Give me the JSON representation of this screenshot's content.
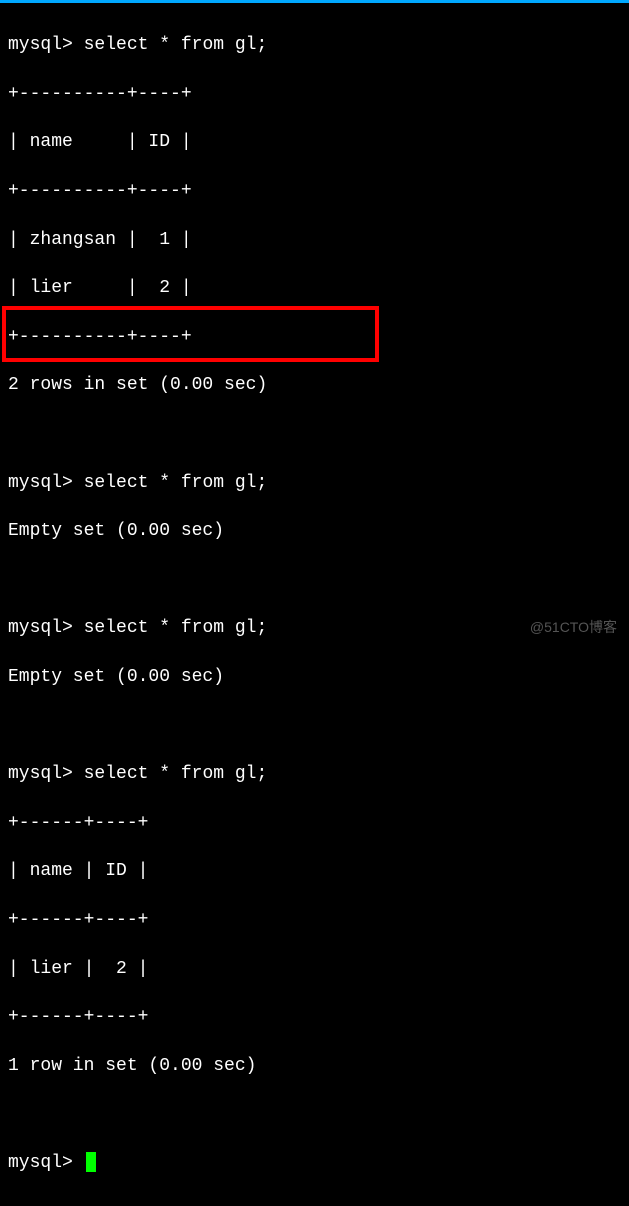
{
  "mysql_prompt": "mysql> ",
  "queries": {
    "q1": "select * from gl;",
    "q2": "select * from gl;",
    "q3": "select * from gl;",
    "q4": "select * from gl;"
  },
  "table1": {
    "border_top": "+----------+----+",
    "header": "| name     | ID |",
    "border_mid": "+----------+----+",
    "row1": "| zhangsan |  1 |",
    "row2": "| lier     |  2 |",
    "border_bot": "+----------+----+",
    "summary": "2 rows in set (0.00 sec)"
  },
  "empty1": "Empty set (0.00 sec)",
  "empty2": "Empty set (0.00 sec)",
  "table2": {
    "border_top": "+------+----+",
    "header": "| name | ID |",
    "border_mid": "+------+----+",
    "row1": "| lier |  2 |",
    "border_bot": "+------+----+",
    "summary": "1 row in set (0.00 sec)"
  },
  "watermark": "@51CTO博客"
}
